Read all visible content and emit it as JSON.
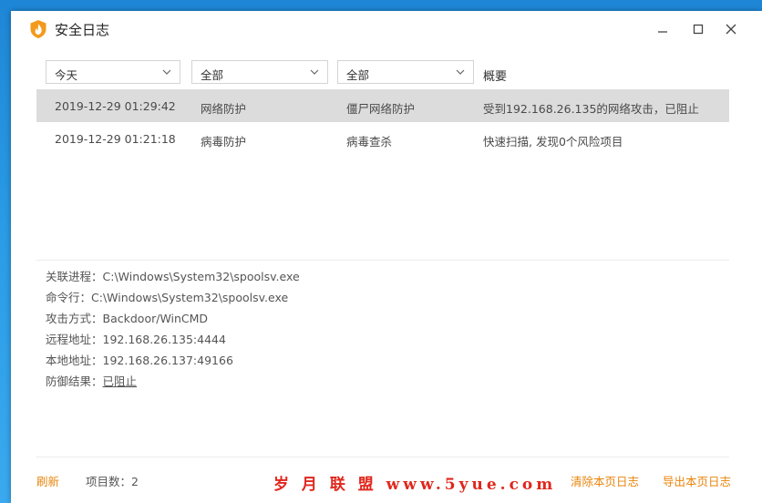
{
  "window": {
    "title": "安全日志",
    "minimize_label": "—",
    "maximize_label": "□",
    "close_label": "✕"
  },
  "filters": {
    "date": "今天",
    "category": "全部",
    "type": "全部",
    "summary_header": "概要"
  },
  "rows": [
    {
      "time": "2019-12-29 01:29:42",
      "category": "网络防护",
      "type": "僵尸网络防护",
      "summary": "受到192.168.26.135的网络攻击，已阻止",
      "selected": true
    },
    {
      "time": "2019-12-29 01:21:18",
      "category": "病毒防护",
      "type": "病毒查杀",
      "summary": "快速扫描, 发现0个风险项目",
      "selected": false
    }
  ],
  "details": [
    {
      "label": "关联进程：",
      "value": "C:\\Windows\\System32\\spoolsv.exe"
    },
    {
      "label": "命令行：",
      "value": "C:\\Windows\\System32\\spoolsv.exe"
    },
    {
      "label": "攻击方式：",
      "value": "Backdoor/WinCMD"
    },
    {
      "label": "远程地址：",
      "value": "192.168.26.135:4444"
    },
    {
      "label": "本地地址：",
      "value": "192.168.26.137:49166"
    },
    {
      "label": "防御结果：",
      "value": "已阻止"
    }
  ],
  "footer": {
    "refresh": "刷新",
    "item_count": "项目数：2",
    "clear_page": "清除本页日志",
    "export_page": "导出本页日志"
  },
  "watermark": "岁 月 联 盟 www.5yue.com",
  "colors": {
    "accent": "#e8850c",
    "selected_row": "#dcdcdc",
    "desktop": "#2a9be6",
    "watermark": "#e0271c"
  },
  "icons": {
    "app": "shield-flame-icon",
    "dropdown": "chevron-down-icon"
  }
}
